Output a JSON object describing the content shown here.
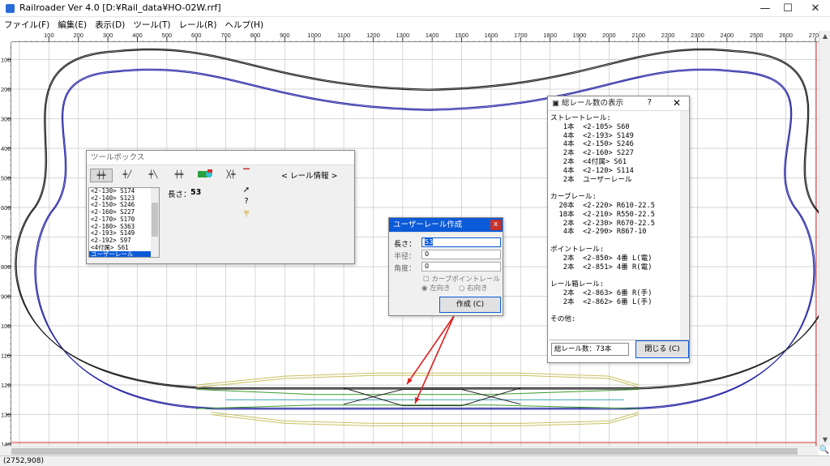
{
  "window": {
    "title": "Railroader Ver 4.0  [D:¥Rail_data¥HO-02W.rrf]",
    "minimize": "—",
    "maximize": "☐",
    "close": "✕"
  },
  "menu": [
    "ファイル(F)",
    "編集(E)",
    "表示(D)",
    "ツール(T)",
    "レール(R)",
    "ヘルプ(H)"
  ],
  "ruler": {
    "x_ticks": [
      100,
      200,
      300,
      400,
      500,
      600,
      700,
      800,
      900,
      1000,
      1100,
      1200,
      1300,
      1400,
      1500,
      1600,
      1700,
      1800,
      1900,
      2000,
      2100,
      2200,
      2300,
      2400,
      2500,
      2600,
      2700
    ],
    "y_ticks": [
      100,
      200,
      300,
      400,
      500,
      600,
      700,
      800,
      900,
      1000,
      1100,
      1200,
      1300,
      1400
    ]
  },
  "status": {
    "coords": "(2752,908)"
  },
  "toolbox": {
    "title": "ツールボックス",
    "info": "< レール情報 >",
    "length_label": "長さ：",
    "length_value": "53",
    "list": [
      "<2-130> S174",
      "<2-140> S123",
      "<2-150> S246",
      "<2-160> S227",
      "<2-170> S170",
      "<2-180> S363",
      "<2-193> S149",
      "<2-192> S97",
      "<4付属> S61",
      "ユーザーレール"
    ],
    "selected_index": 9,
    "tools": [
      "ポイント1",
      "ポイント2",
      "ポイント3",
      "ポイント4",
      "信号",
      "クロス"
    ]
  },
  "user_rail": {
    "title": "ユーザーレール作成",
    "length_label": "長さ：",
    "length_value": "53",
    "radius_label": "半径：",
    "radius_value": "0",
    "angle_label": "角度：",
    "angle_value": "0",
    "curve_point": "カーブポイントレール",
    "left": "左向き",
    "right": "右向き",
    "create_button": "作成 (C)"
  },
  "total": {
    "title": "総レール数の表示",
    "help": "?",
    "close": "✕",
    "body": "ストレートレール:\n   1本  <2-105> S60\n   4本  <2-193> S149\n   4本  <2-150> S246\n   2本  <2-160> S227\n   2本  <4付属> S61\n   4本  <2-120> S114\n   2本  ユーザーレール\n\nカーブレール:\n  20本  <2-220> R610-22.5\n  18本  <2-210> R550-22.5\n   2本  <2-230> R670-22.5\n   4本  <2-290> R867-10\n\nポイントレール:\n   2本  <2-850> 4番 L(電)\n   2本  <2-851> 4番 R(電)\n\nレール箱レール:\n   2本  <2-863> 6番 R(手)\n   2本  <2-862> 6番 L(手)\n\nその他:",
    "count": "総レール数：73本",
    "close_button": "閉じる (C)"
  },
  "colors": {
    "grid": "#c8c8c8",
    "outer_track": "#2b2ba8",
    "inner_track": "#222222",
    "green_track": "#3a9a2a",
    "yellow_track": "#c8c060",
    "cyan_track": "#3aa0b0",
    "red_arrow": "#e02020",
    "border_red": "#e03030",
    "accent": "#0b5ad8"
  }
}
